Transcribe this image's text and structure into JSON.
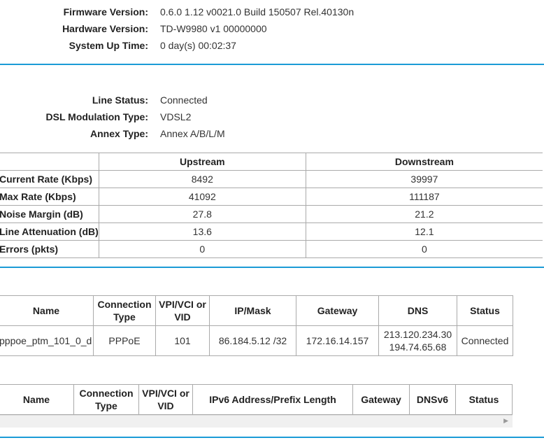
{
  "device": {
    "firmware_label": "Firmware Version:",
    "firmware_value": "0.6.0 1.12 v0021.0 Build 150507 Rel.40130n",
    "hardware_label": "Hardware Version:",
    "hardware_value": "TD-W9980 v1 00000000",
    "uptime_label": "System Up Time:",
    "uptime_value": "0 day(s) 00:02:37"
  },
  "dsl": {
    "line_status_label": "Line Status:",
    "line_status_value": "Connected",
    "modulation_label": "DSL Modulation Type:",
    "modulation_value": "VDSL2",
    "annex_label": "Annex Type:",
    "annex_value": "Annex A/B/L/M",
    "table": {
      "headers": [
        "",
        "Upstream",
        "Downstream"
      ],
      "rows": [
        {
          "label": "Current Rate (Kbps)",
          "up": "8492",
          "down": "39997"
        },
        {
          "label": "Max Rate (Kbps)",
          "up": "41092",
          "down": "111187"
        },
        {
          "label": "Noise Margin (dB)",
          "up": "27.8",
          "down": "21.2"
        },
        {
          "label": "Line Attenuation (dB)",
          "up": "13.6",
          "down": "12.1"
        },
        {
          "label": "Errors (pkts)",
          "up": "0",
          "down": "0"
        }
      ]
    }
  },
  "wan": {
    "headers": {
      "name": "Name",
      "conn_type": "Connection Type",
      "vpi": "VPI/VCI or VID",
      "ipmask": "IP/Mask",
      "gateway": "Gateway",
      "dns": "DNS",
      "status": "Status"
    },
    "row": {
      "name": "pppoe_ptm_101_0_d",
      "conn_type": "PPPoE",
      "vpi": "101",
      "ipmask": "86.184.5.12 /32",
      "gateway": "172.16.14.157",
      "dns1": "213.120.234.30",
      "dns2": "194.74.65.68",
      "status": "Connected"
    }
  },
  "ipv6": {
    "headers": {
      "name": "Name",
      "conn_type": "Connection Type",
      "vpi": "VPI/VCI or VID",
      "addr": "IPv6 Address/Prefix Length",
      "gateway": "Gateway",
      "dns": "DNSv6",
      "status": "Status"
    }
  },
  "colors": {
    "divider": "#1b9bd6"
  },
  "icons": {
    "scroll_right": "scroll-right-arrow-icon"
  }
}
